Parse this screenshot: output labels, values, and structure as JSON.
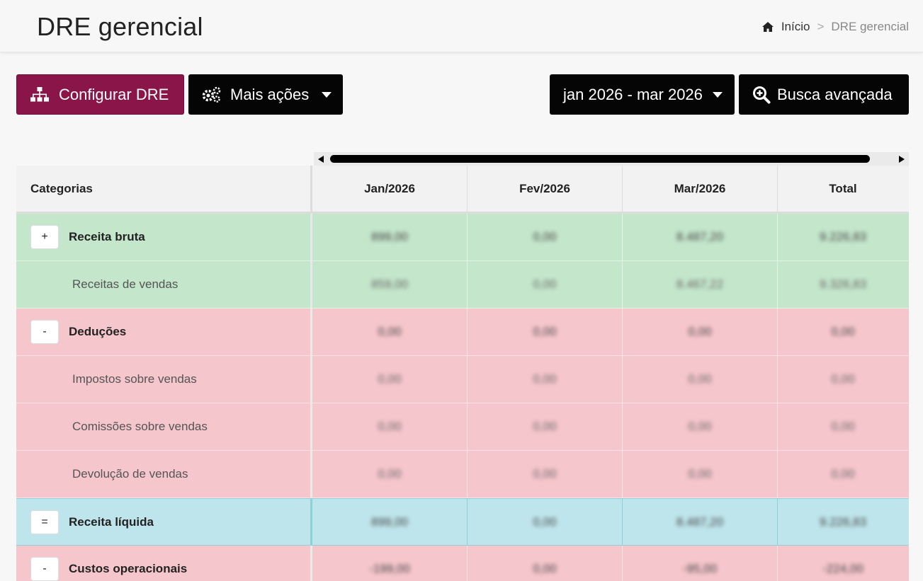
{
  "header": {
    "title": "DRE gerencial",
    "breadcrumb": {
      "home": "Início",
      "separator": ">",
      "current": "DRE gerencial"
    }
  },
  "toolbar": {
    "config_label": "Configurar DRE",
    "more_label": "Mais ações",
    "date_range": "jan 2026 - mar 2026",
    "search_label": "Busca avançada"
  },
  "colors": {
    "primary": "#8a1548",
    "receita": "#c4e6cb",
    "deducao": "#f5c6cb",
    "resultado": "#bee5eb"
  },
  "table": {
    "columns": [
      "Categorias",
      "Jan/2026",
      "Fev/2026",
      "Mar/2026",
      "Total"
    ],
    "rows": [
      {
        "toggle": "+",
        "label": "Receita bruta",
        "values": [
          "899,00",
          "0,00",
          "8.487,20",
          "9.226,83"
        ]
      },
      {
        "label": "Receitas de vendas",
        "values": [
          "859,00",
          "0,00",
          "8.467,22",
          "9.326,83"
        ]
      },
      {
        "toggle": "-",
        "label": "Deduções",
        "values": [
          "0,00",
          "0,00",
          "0,00",
          "0,00"
        ]
      },
      {
        "label": "Impostos sobre vendas",
        "values": [
          "0,00",
          "0,00",
          "0,00",
          "0,00"
        ]
      },
      {
        "label": "Comissões sobre vendas",
        "values": [
          "0,00",
          "0,00",
          "0,00",
          "0,00"
        ]
      },
      {
        "label": "Devolução de vendas",
        "values": [
          "0,00",
          "0,00",
          "0,00",
          "0,00"
        ]
      },
      {
        "toggle": "=",
        "label": "Receita líquida",
        "values": [
          "899,00",
          "0,00",
          "8.487,20",
          "9.226,83"
        ]
      },
      {
        "toggle": "-",
        "label": "Custos operacionais",
        "values": [
          "-199,00",
          "0,00",
          "-95,00",
          "-224,00"
        ]
      }
    ]
  }
}
